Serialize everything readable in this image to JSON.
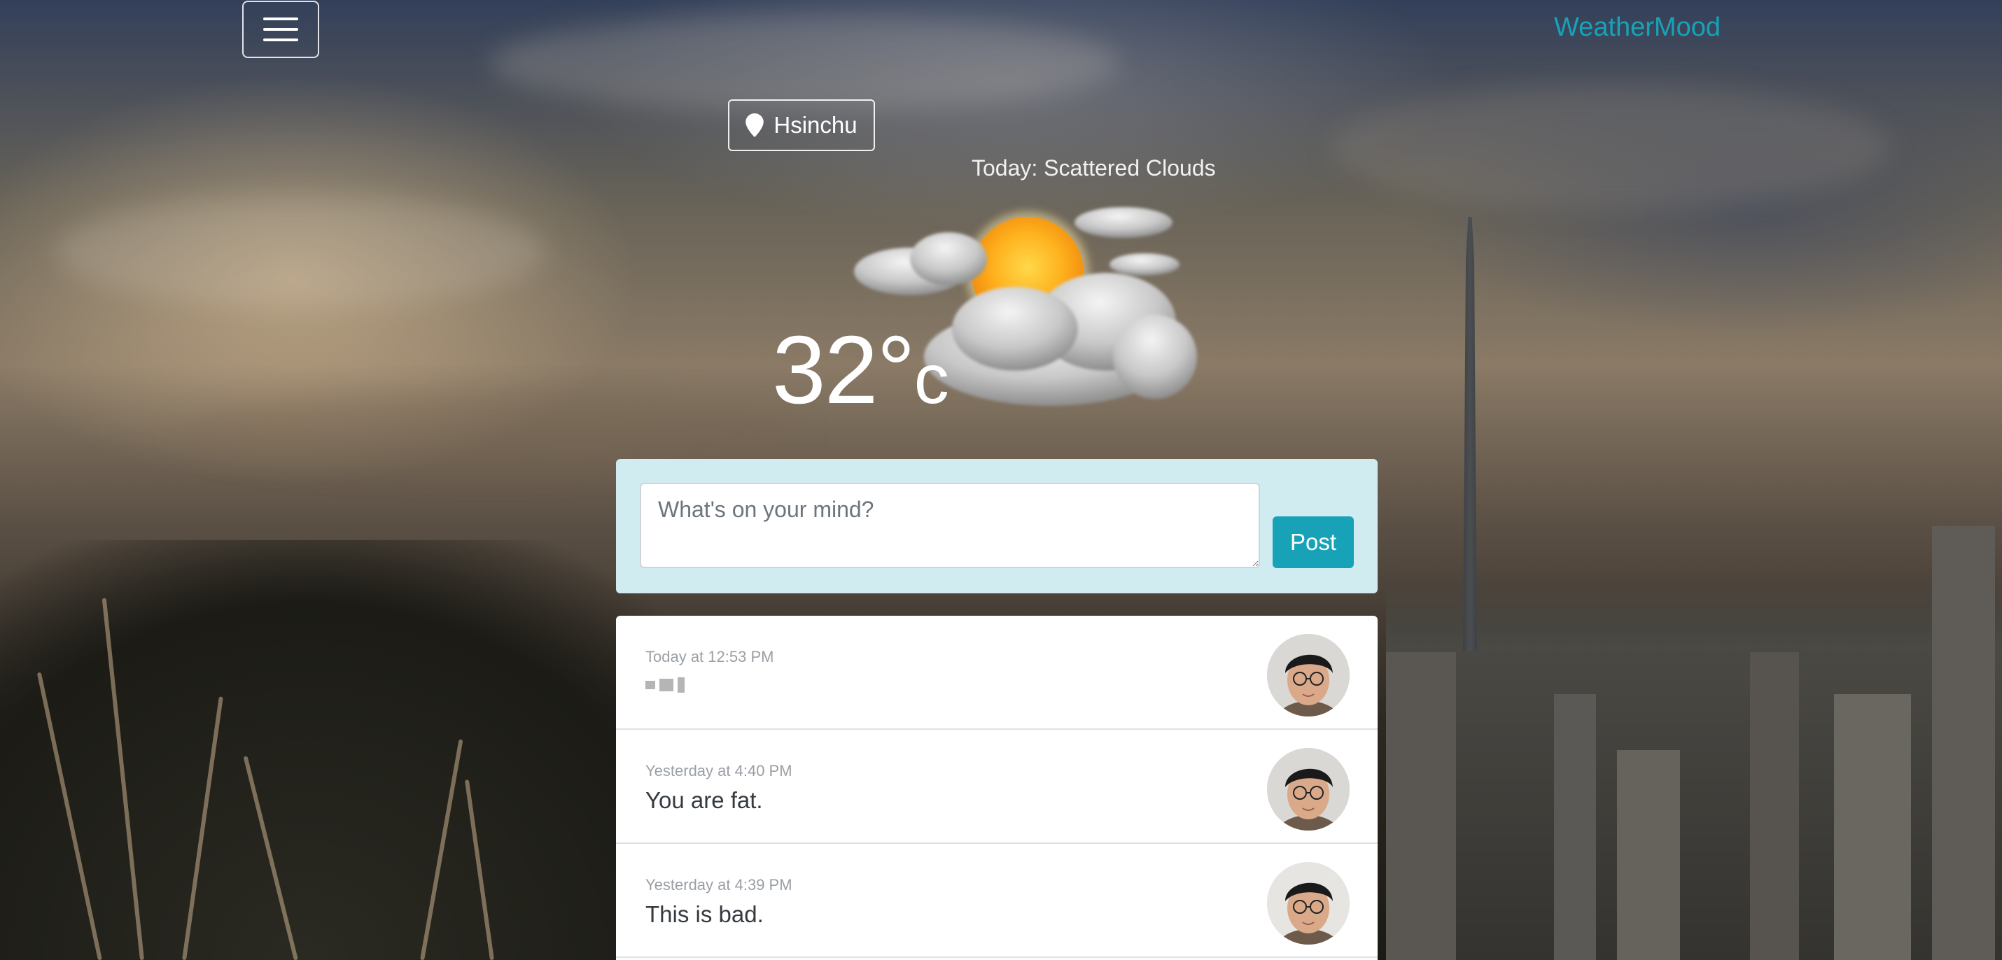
{
  "header": {
    "menu_icon": "hamburger-icon",
    "brand": "WeatherMood"
  },
  "weather": {
    "location": "Hsinchu",
    "location_icon": "map-pin-icon",
    "condition_label": "Today: Scattered Clouds",
    "icon": "partly-cloudy-icon",
    "temperature": "32°",
    "unit": "c"
  },
  "composer": {
    "placeholder": "What's on your mind?",
    "value": "",
    "post_label": "Post"
  },
  "feed": {
    "posts": [
      {
        "time": "Today at 12:53 PM",
        "text": ""
      },
      {
        "time": "Yesterday at 4:40 PM",
        "text": "You are fat."
      },
      {
        "time": "Yesterday at 4:39 PM",
        "text": "This is bad."
      }
    ]
  },
  "colors": {
    "accent": "#17a2b8",
    "composer_bg": "#d1ecf1"
  }
}
